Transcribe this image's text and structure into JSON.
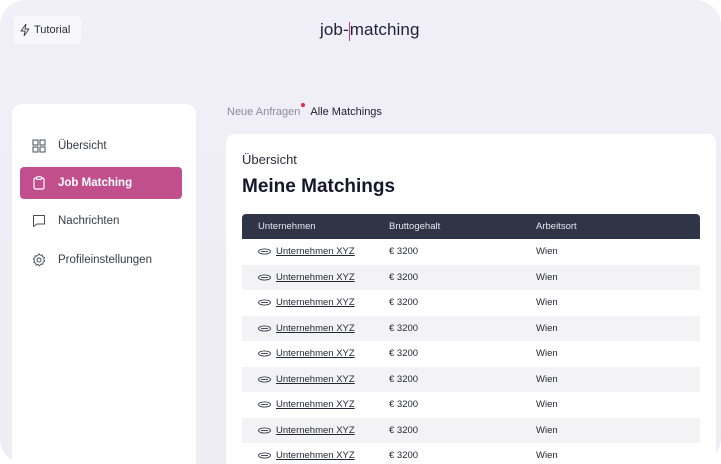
{
  "header": {
    "tutorial_label": "Tutorial",
    "logo_part1": "job-",
    "logo_part2": "matching"
  },
  "sidebar": {
    "items": [
      {
        "label": "Übersicht",
        "icon": "grid-icon",
        "active": false
      },
      {
        "label": "Job Matching",
        "icon": "clipboard-icon",
        "active": true
      },
      {
        "label": "Nachrichten",
        "icon": "chat-icon",
        "active": false
      },
      {
        "label": "Profileinstellungen",
        "icon": "gear-icon",
        "active": false
      }
    ]
  },
  "tabs": [
    {
      "label": "Neue Anfragen",
      "has_notification": true
    },
    {
      "label": "Alle Matchings",
      "active": true
    }
  ],
  "main": {
    "subtitle": "Übersicht",
    "title": "Meine Matchings",
    "table": {
      "columns": [
        "Unternehmen",
        "Bruttogehalt",
        "Arbeitsort"
      ],
      "rows": [
        {
          "company": "Unternehmen XYZ",
          "salary": "€ 3200",
          "location": "Wien"
        },
        {
          "company": "Unternehmen XYZ",
          "salary": "€ 3200",
          "location": "Wien"
        },
        {
          "company": "Unternehmen XYZ",
          "salary": "€ 3200",
          "location": "Wien"
        },
        {
          "company": "Unternehmen XYZ",
          "salary": "€ 3200",
          "location": "Wien"
        },
        {
          "company": "Unternehmen XYZ",
          "salary": "€ 3200",
          "location": "Wien"
        },
        {
          "company": "Unternehmen XYZ",
          "salary": "€ 3200",
          "location": "Wien"
        },
        {
          "company": "Unternehmen XYZ",
          "salary": "€ 3200",
          "location": "Wien"
        },
        {
          "company": "Unternehmen XYZ",
          "salary": "€ 3200",
          "location": "Wien"
        },
        {
          "company": "Unternehmen XYZ",
          "salary": "€ 3200",
          "location": "Wien"
        }
      ]
    }
  },
  "colors": {
    "accent": "#c24f8d",
    "table_header": "#2f3447",
    "notification": "#e0284f"
  }
}
